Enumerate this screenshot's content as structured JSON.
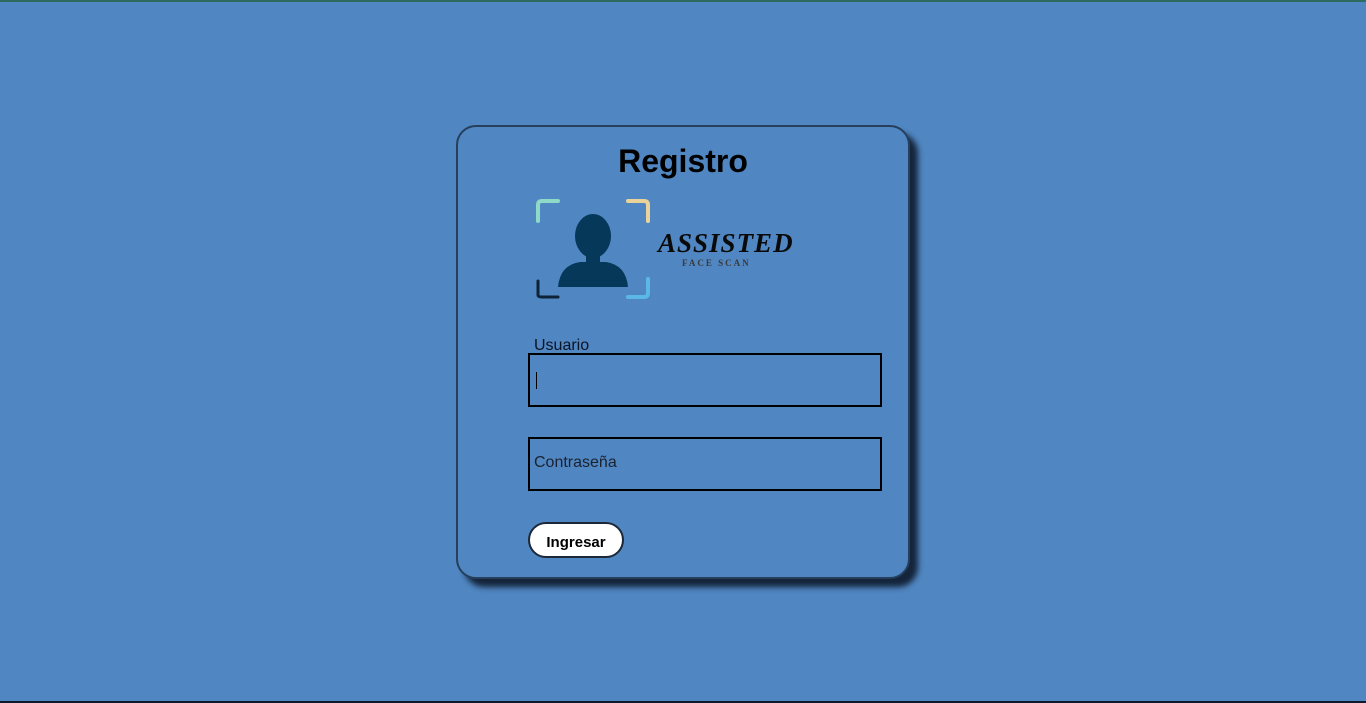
{
  "form": {
    "title": "Registro",
    "username_label": "Usuario",
    "username_value": "",
    "password_placeholder": "Contraseña",
    "submit_label": "Ingresar"
  },
  "logo": {
    "wordmark": "ASSISTED",
    "tagline": "FACE SCAN",
    "icon": "face-scan-icon"
  },
  "colors": {
    "background": "#5086c1",
    "card_border": "#253f5d",
    "button_background": "#ffffff",
    "logo_figure": "#06385a"
  }
}
